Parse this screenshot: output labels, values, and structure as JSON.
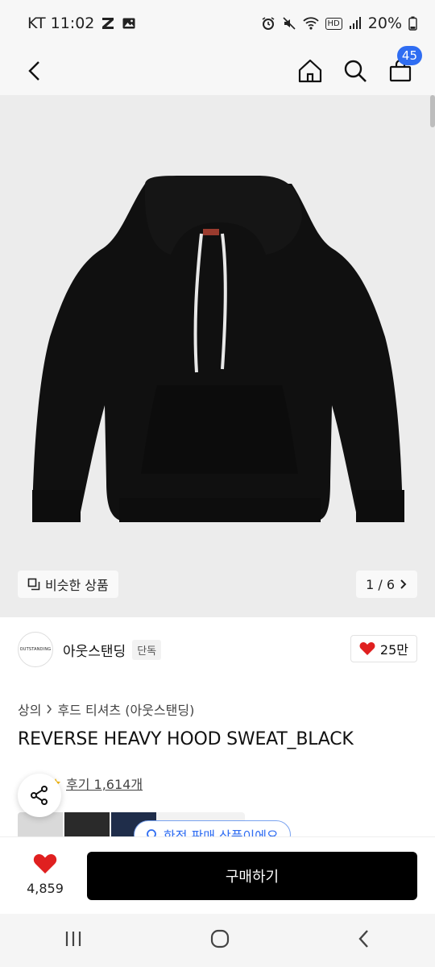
{
  "status_bar": {
    "carrier_time": "KT 11:02",
    "battery": "20%",
    "hd_label": "HD"
  },
  "app_bar": {
    "cart_count": "45",
    "icons": [
      "back-arrow-icon",
      "home-icon",
      "search-icon",
      "cart-icon"
    ]
  },
  "product_image": {
    "similar_label": "비슷한 상품",
    "pager": "1 / 6"
  },
  "brand": {
    "logo_text": "OUTSTANDING",
    "name": "아웃스탠딩",
    "exclusive_tag": "단독",
    "likes": "25만"
  },
  "breadcrumb": {
    "category": "상의",
    "subcategory": "후드 티셔츠 (아웃스탠딩)"
  },
  "product": {
    "title": "REVERSE HEAVY HOOD SWEAT_BLACK",
    "reviews": "후기 1,614개",
    "exclusive_banner": "한정 판매 상품이에요"
  },
  "buy_bar": {
    "wish_count": "4,859",
    "buy_label": "구매하기"
  },
  "colors": {
    "accent": "#2f6df2",
    "heart": "#e02020",
    "buy_button": "#000000"
  }
}
